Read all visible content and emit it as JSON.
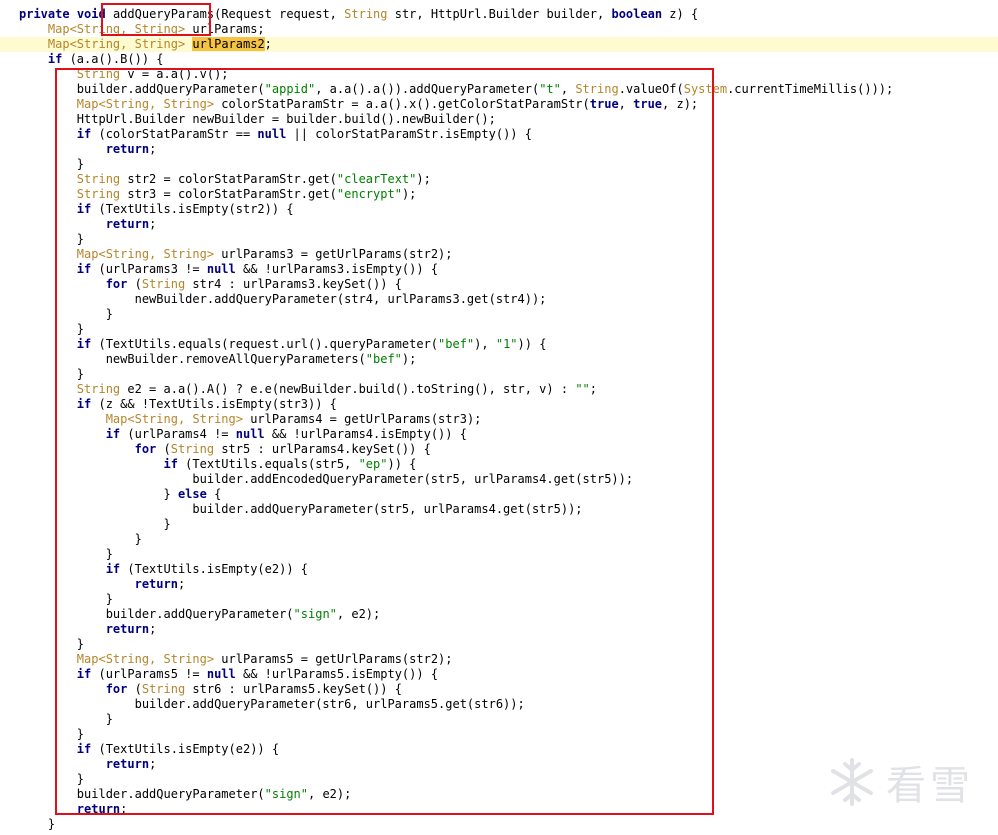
{
  "editor": {
    "highlight_line": 3,
    "watermark_text": "看雪",
    "lines": [
      [
        [
          "kw",
          "private"
        ],
        [
          "plain",
          " "
        ],
        [
          "kw",
          "void"
        ],
        [
          "plain",
          " addQueryParams(Request request, "
        ],
        [
          "ty",
          "String"
        ],
        [
          "plain",
          " str, HttpUrl.Builder builder, "
        ],
        [
          "kw",
          "boolean"
        ],
        [
          "plain",
          " z) {"
        ]
      ],
      [
        [
          "plain",
          "    "
        ],
        [
          "ty",
          "Map<String, String>"
        ],
        [
          "plain",
          " urlParams;"
        ]
      ],
      [
        [
          "plain",
          "    "
        ],
        [
          "ty",
          "Map<String, String>"
        ],
        [
          "plain",
          " "
        ],
        [
          "sel",
          "urlParams2"
        ],
        [
          "plain",
          ";"
        ]
      ],
      [
        [
          "plain",
          "    "
        ],
        [
          "kw",
          "if"
        ],
        [
          "plain",
          " (a.a().B()) {"
        ]
      ],
      [
        [
          "plain",
          "        "
        ],
        [
          "ty",
          "String"
        ],
        [
          "plain",
          " v = a.a().v();"
        ]
      ],
      [
        [
          "plain",
          "        builder.addQueryParameter("
        ],
        [
          "str",
          "\"appid\""
        ],
        [
          "plain",
          ", a.a().a()).addQueryParameter("
        ],
        [
          "str",
          "\"t\""
        ],
        [
          "plain",
          ", "
        ],
        [
          "ty",
          "String"
        ],
        [
          "plain",
          ".valueOf("
        ],
        [
          "ty",
          "System"
        ],
        [
          "plain",
          ".currentTimeMillis()));"
        ]
      ],
      [
        [
          "plain",
          "        "
        ],
        [
          "ty",
          "Map<String, String>"
        ],
        [
          "plain",
          " colorStatParamStr = a.a().x().getColorStatParamStr("
        ],
        [
          "kw",
          "true"
        ],
        [
          "plain",
          ", "
        ],
        [
          "kw",
          "true"
        ],
        [
          "plain",
          ", z);"
        ]
      ],
      [
        [
          "plain",
          "        HttpUrl.Builder newBuilder = builder.build().newBuilder();"
        ]
      ],
      [
        [
          "plain",
          "        "
        ],
        [
          "kw",
          "if"
        ],
        [
          "plain",
          " (colorStatParamStr == "
        ],
        [
          "kw",
          "null"
        ],
        [
          "plain",
          " || colorStatParamStr.isEmpty()) {"
        ]
      ],
      [
        [
          "plain",
          "            "
        ],
        [
          "kw",
          "return"
        ],
        [
          "plain",
          ";"
        ]
      ],
      [
        [
          "plain",
          "        }"
        ]
      ],
      [
        [
          "plain",
          "        "
        ],
        [
          "ty",
          "String"
        ],
        [
          "plain",
          " str2 = colorStatParamStr.get("
        ],
        [
          "str",
          "\"clearText\""
        ],
        [
          "plain",
          ");"
        ]
      ],
      [
        [
          "plain",
          "        "
        ],
        [
          "ty",
          "String"
        ],
        [
          "plain",
          " str3 = colorStatParamStr.get("
        ],
        [
          "str",
          "\"encrypt\""
        ],
        [
          "plain",
          ");"
        ]
      ],
      [
        [
          "plain",
          "        "
        ],
        [
          "kw",
          "if"
        ],
        [
          "plain",
          " (TextUtils.isEmpty(str2)) {"
        ]
      ],
      [
        [
          "plain",
          "            "
        ],
        [
          "kw",
          "return"
        ],
        [
          "plain",
          ";"
        ]
      ],
      [
        [
          "plain",
          "        }"
        ]
      ],
      [
        [
          "plain",
          "        "
        ],
        [
          "ty",
          "Map<String, String>"
        ],
        [
          "plain",
          " urlParams3 = getUrlParams(str2);"
        ]
      ],
      [
        [
          "plain",
          "        "
        ],
        [
          "kw",
          "if"
        ],
        [
          "plain",
          " (urlParams3 != "
        ],
        [
          "kw",
          "null"
        ],
        [
          "plain",
          " && !urlParams3.isEmpty()) {"
        ]
      ],
      [
        [
          "plain",
          "            "
        ],
        [
          "kw",
          "for"
        ],
        [
          "plain",
          " ("
        ],
        [
          "ty",
          "String"
        ],
        [
          "plain",
          " str4 : urlParams3.keySet()) {"
        ]
      ],
      [
        [
          "plain",
          "                newBuilder.addQueryParameter(str4, urlParams3.get(str4));"
        ]
      ],
      [
        [
          "plain",
          "            }"
        ]
      ],
      [
        [
          "plain",
          "        }"
        ]
      ],
      [
        [
          "plain",
          "        "
        ],
        [
          "kw",
          "if"
        ],
        [
          "plain",
          " (TextUtils.equals(request.url().queryParameter("
        ],
        [
          "str",
          "\"bef\""
        ],
        [
          "plain",
          "), "
        ],
        [
          "str",
          "\"1\""
        ],
        [
          "plain",
          ")) {"
        ]
      ],
      [
        [
          "plain",
          "            newBuilder.removeAllQueryParameters("
        ],
        [
          "str",
          "\"bef\""
        ],
        [
          "plain",
          ");"
        ]
      ],
      [
        [
          "plain",
          "        }"
        ]
      ],
      [
        [
          "plain",
          "        "
        ],
        [
          "ty",
          "String"
        ],
        [
          "plain",
          " e2 = a.a().A() ? e.e(newBuilder.build().toString(), str, v) : "
        ],
        [
          "str",
          "\"\""
        ],
        [
          "plain",
          ";"
        ]
      ],
      [
        [
          "plain",
          "        "
        ],
        [
          "kw",
          "if"
        ],
        [
          "plain",
          " (z && !TextUtils.isEmpty(str3)) {"
        ]
      ],
      [
        [
          "plain",
          "            "
        ],
        [
          "ty",
          "Map<String, String>"
        ],
        [
          "plain",
          " urlParams4 = getUrlParams(str3);"
        ]
      ],
      [
        [
          "plain",
          "            "
        ],
        [
          "kw",
          "if"
        ],
        [
          "plain",
          " (urlParams4 != "
        ],
        [
          "kw",
          "null"
        ],
        [
          "plain",
          " && !urlParams4.isEmpty()) {"
        ]
      ],
      [
        [
          "plain",
          "                "
        ],
        [
          "kw",
          "for"
        ],
        [
          "plain",
          " ("
        ],
        [
          "ty",
          "String"
        ],
        [
          "plain",
          " str5 : urlParams4.keySet()) {"
        ]
      ],
      [
        [
          "plain",
          "                    "
        ],
        [
          "kw",
          "if"
        ],
        [
          "plain",
          " (TextUtils.equals(str5, "
        ],
        [
          "str",
          "\"ep\""
        ],
        [
          "plain",
          ")) {"
        ]
      ],
      [
        [
          "plain",
          "                        builder.addEncodedQueryParameter(str5, urlParams4.get(str5));"
        ]
      ],
      [
        [
          "plain",
          "                    } "
        ],
        [
          "kw",
          "else"
        ],
        [
          "plain",
          " {"
        ]
      ],
      [
        [
          "plain",
          "                        builder.addQueryParameter(str5, urlParams4.get(str5));"
        ]
      ],
      [
        [
          "plain",
          "                    }"
        ]
      ],
      [
        [
          "plain",
          "                }"
        ]
      ],
      [
        [
          "plain",
          "            }"
        ]
      ],
      [
        [
          "plain",
          "            "
        ],
        [
          "kw",
          "if"
        ],
        [
          "plain",
          " (TextUtils.isEmpty(e2)) {"
        ]
      ],
      [
        [
          "plain",
          "                "
        ],
        [
          "kw",
          "return"
        ],
        [
          "plain",
          ";"
        ]
      ],
      [
        [
          "plain",
          "            }"
        ]
      ],
      [
        [
          "plain",
          "            builder.addQueryParameter("
        ],
        [
          "str",
          "\"sign\""
        ],
        [
          "plain",
          ", e2);"
        ]
      ],
      [
        [
          "plain",
          "            "
        ],
        [
          "kw",
          "return"
        ],
        [
          "plain",
          ";"
        ]
      ],
      [
        [
          "plain",
          "        }"
        ]
      ],
      [
        [
          "plain",
          "        "
        ],
        [
          "ty",
          "Map<String, String>"
        ],
        [
          "plain",
          " urlParams5 = getUrlParams(str2);"
        ]
      ],
      [
        [
          "plain",
          "        "
        ],
        [
          "kw",
          "if"
        ],
        [
          "plain",
          " (urlParams5 != "
        ],
        [
          "kw",
          "null"
        ],
        [
          "plain",
          " && !urlParams5.isEmpty()) {"
        ]
      ],
      [
        [
          "plain",
          "            "
        ],
        [
          "kw",
          "for"
        ],
        [
          "plain",
          " ("
        ],
        [
          "ty",
          "String"
        ],
        [
          "plain",
          " str6 : urlParams5.keySet()) {"
        ]
      ],
      [
        [
          "plain",
          "                builder.addQueryParameter(str6, urlParams5.get(str6));"
        ]
      ],
      [
        [
          "plain",
          "            }"
        ]
      ],
      [
        [
          "plain",
          "        }"
        ]
      ],
      [
        [
          "plain",
          "        "
        ],
        [
          "kw",
          "if"
        ],
        [
          "plain",
          " (TextUtils.isEmpty(e2)) {"
        ]
      ],
      [
        [
          "plain",
          "            "
        ],
        [
          "kw",
          "return"
        ],
        [
          "plain",
          ";"
        ]
      ],
      [
        [
          "plain",
          "        }"
        ]
      ],
      [
        [
          "plain",
          "        builder.addQueryParameter("
        ],
        [
          "str",
          "\"sign\""
        ],
        [
          "plain",
          ", e2);"
        ]
      ],
      [
        [
          "plain",
          "        "
        ],
        [
          "kw",
          "return"
        ],
        [
          "plain",
          ";"
        ]
      ],
      [
        [
          "plain",
          "    }"
        ]
      ]
    ]
  }
}
